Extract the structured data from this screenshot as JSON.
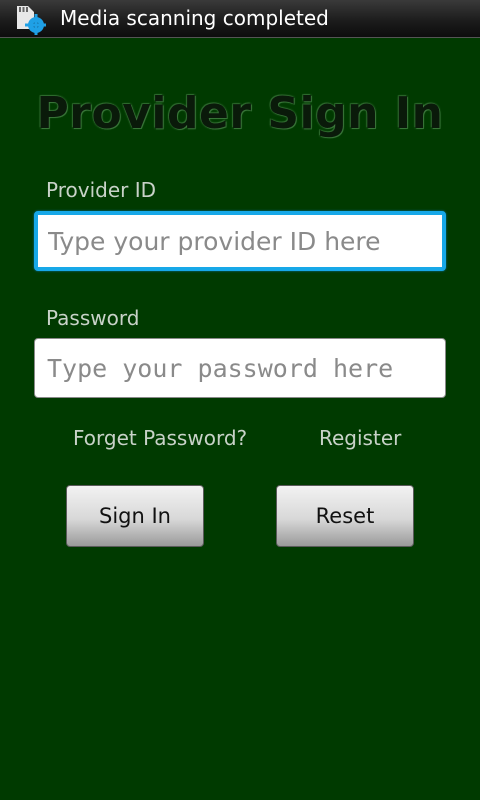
{
  "status_bar": {
    "notification_icon": "sd-card-gear-icon",
    "text": "Media scanning completed"
  },
  "form": {
    "title": "Provider Sign In",
    "provider_label": "Provider ID",
    "provider_placeholder": "Type your provider ID here",
    "password_label": "Password",
    "password_placeholder": "Type your password here"
  },
  "links": {
    "forget_password": "Forget Password?",
    "register": "Register"
  },
  "buttons": {
    "sign_in": "Sign In",
    "reset": "Reset"
  },
  "colors": {
    "background": "#003a00",
    "focus_border": "#17a8e8"
  }
}
